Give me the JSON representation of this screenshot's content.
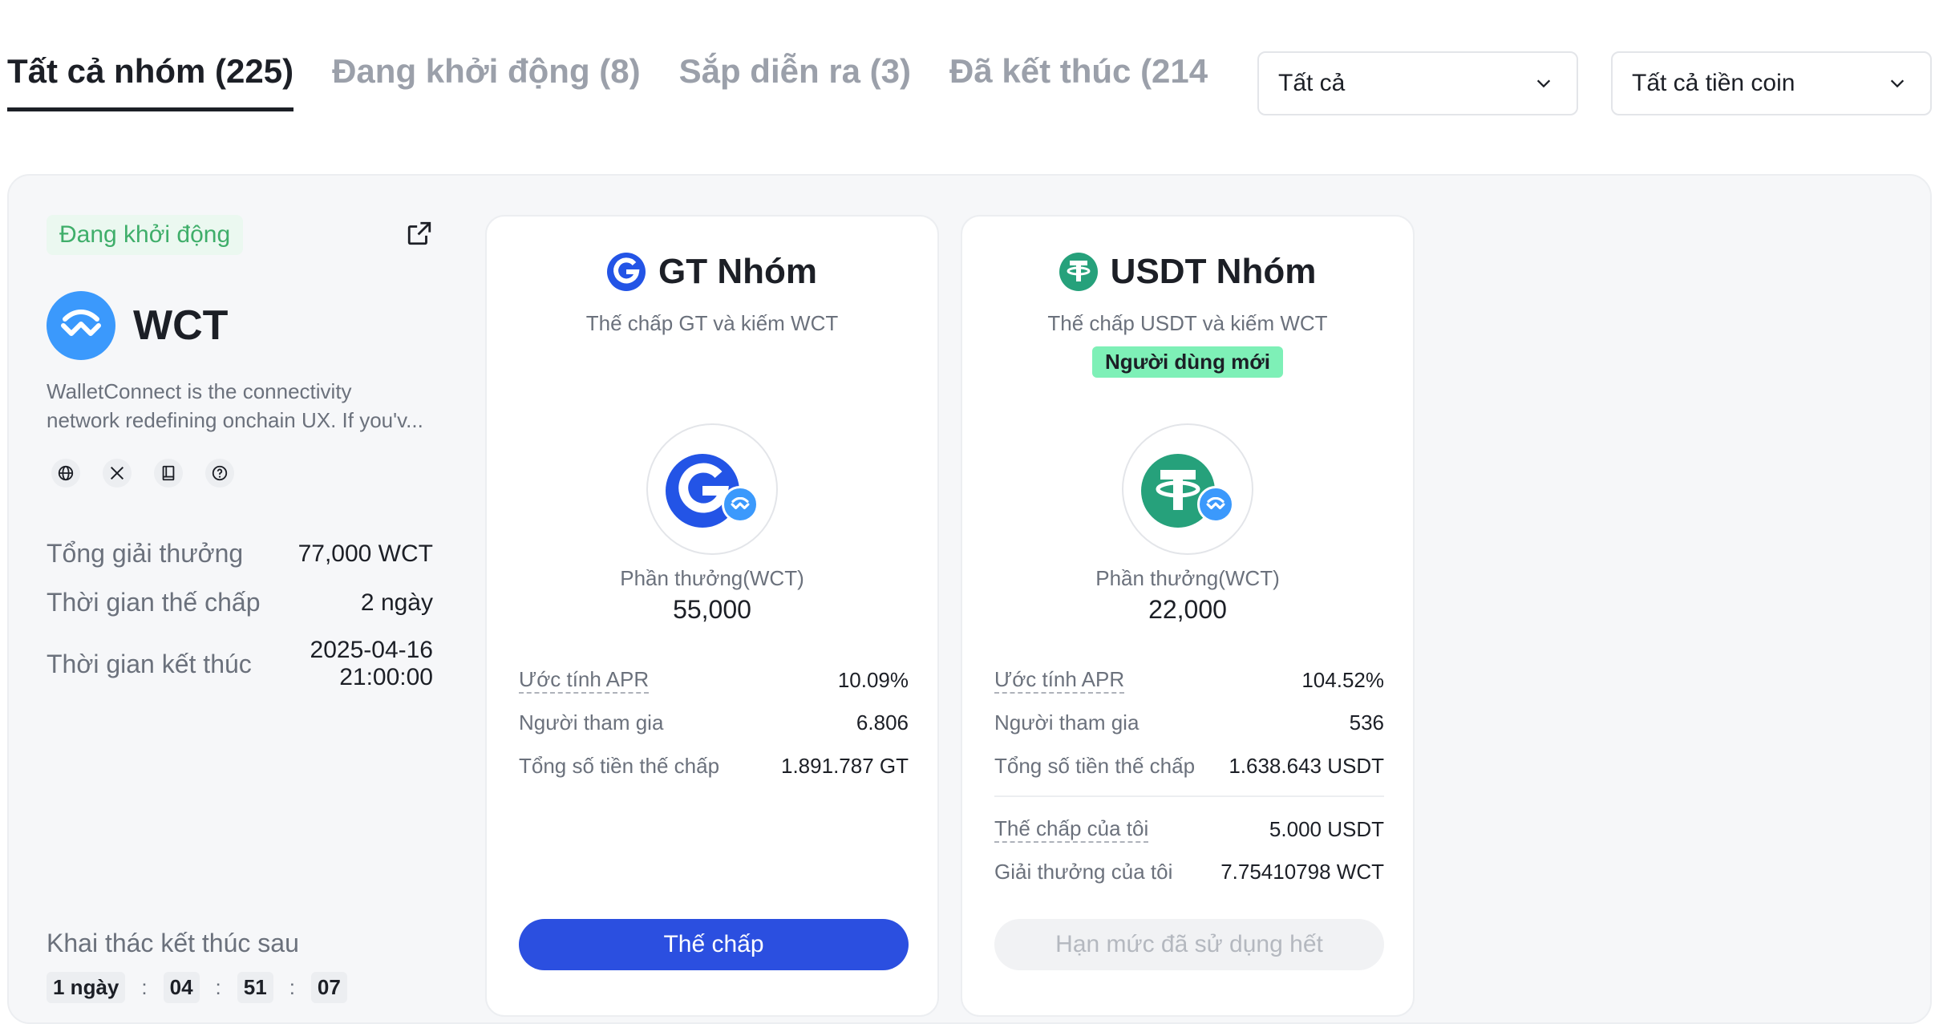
{
  "tabs": [
    {
      "label": "Tất cả nhóm (225)",
      "active": true
    },
    {
      "label": "Đang khởi động (8)",
      "active": false
    },
    {
      "label": "Sắp diễn ra (3)",
      "active": false
    },
    {
      "label": "Đã kết thúc (214",
      "active": false
    }
  ],
  "filters": {
    "group": "Tất cả",
    "coin": "Tất cả tiền coin"
  },
  "project": {
    "status": "Đang khởi động",
    "name": "WCT",
    "description_line1": "WalletConnect is the connectivity",
    "description_line2": "network redefining onchain UX. If you'v...",
    "socials": [
      "globe-icon",
      "x-icon",
      "book-icon",
      "help-icon"
    ],
    "total_reward_label": "Tổng giải thưởng",
    "total_reward": "77,000 WCT",
    "stake_time_label": "Thời gian thế chấp",
    "stake_time": "2 ngày",
    "end_time_label": "Thời gian kết thúc",
    "end_date": "2025-04-16",
    "end_clock": "21:00:00",
    "mining_label": "Khai thác kết thúc sau",
    "countdown": {
      "days": "1 ngày",
      "hours": "04",
      "minutes": "51",
      "seconds": "07",
      "sep": ":"
    }
  },
  "pools": {
    "gt": {
      "title": "GT Nhóm",
      "subtitle": "Thế chấp GT và kiếm WCT",
      "reward_label": "Phần thưởng(WCT)",
      "reward": "55,000",
      "apr_label": "Ước tính APR",
      "apr": "10.09%",
      "participants_label": "Người tham gia",
      "participants": "6.806",
      "total_staked_label": "Tổng số tiền thế chấp",
      "total_staked": "1.891.787 GT",
      "button": "Thế chấp",
      "brand_color": "#2354e6"
    },
    "usdt": {
      "title": "USDT Nhóm",
      "subtitle": "Thế chấp USDT và kiếm WCT",
      "badge": "Người dùng mới",
      "reward_label": "Phần thưởng(WCT)",
      "reward": "22,000",
      "apr_label": "Ước tính APR",
      "apr": "104.52%",
      "participants_label": "Người tham gia",
      "participants": "536",
      "total_staked_label": "Tổng số tiền thế chấp",
      "total_staked": "1.638.643 USDT",
      "my_stake_label": "Thế chấp của tôi",
      "my_stake": "5.000 USDT",
      "my_reward_label": "Giải thưởng của tôi",
      "my_reward": "7.75410798 WCT",
      "button": "Hạn mức đã sử dụng hết",
      "brand_color": "#26a17b"
    }
  }
}
